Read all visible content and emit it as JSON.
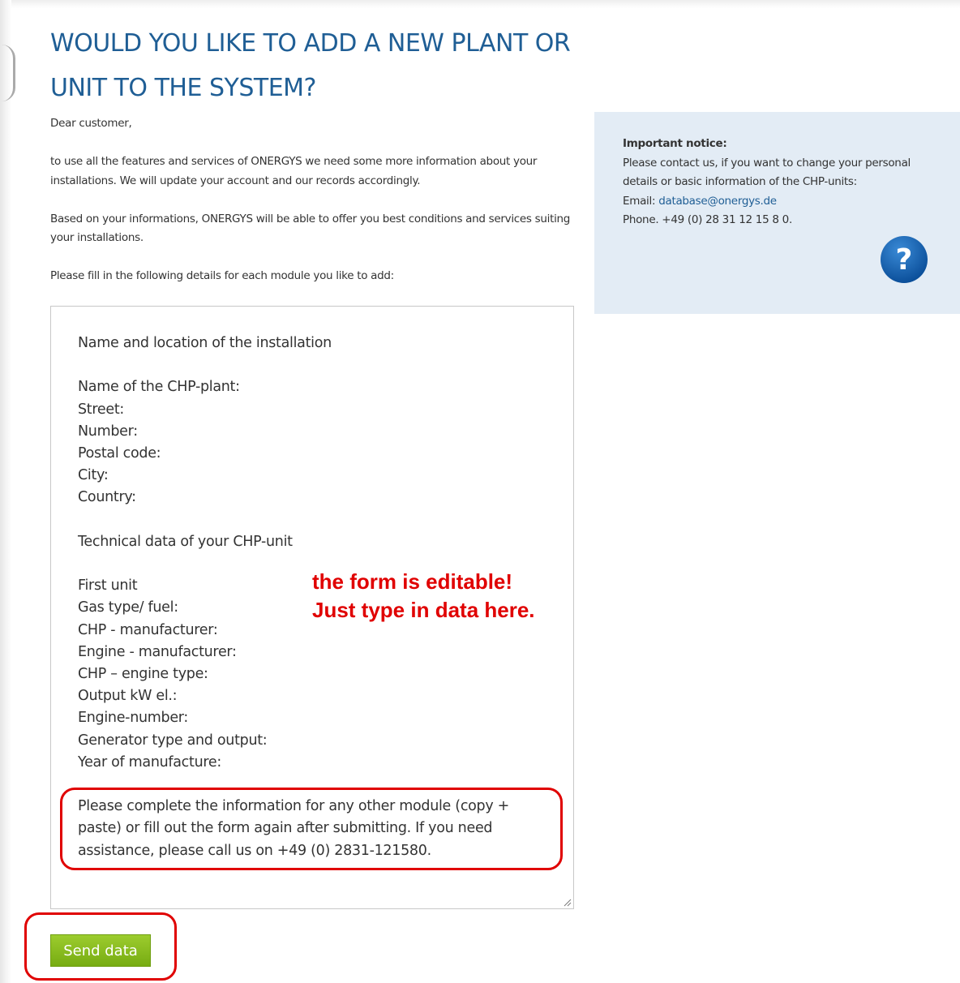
{
  "title": "WOULD YOU LIKE TO ADD A NEW PLANT OR UNIT TO THE SYSTEM?",
  "intro": {
    "greeting": "Dear customer,",
    "paragraph1": "to use all the features and services of ONERGYS we need some more information about your installations. We will update your account and our records accordingly.",
    "paragraph2": "Based on your informations, ONERGYS will be able to offer you best conditions and services suiting your installations.",
    "paragraph3": "Please fill in the following details for each module you like to add:"
  },
  "notice": {
    "title": "Important notice:",
    "body": "Please contact us, if you want to change your personal details or basic information of the CHP-units:",
    "email_label": "Email: ",
    "email": "database@onergys.de",
    "phone": "Phone. +49 (0) 28 31  12 15 8 0.",
    "help_icon": "question-mark-icon",
    "help_symbol": "?"
  },
  "form": {
    "section1_heading": "Name and location of the installation",
    "section1_fields": [
      "Name of the CHP-plant:",
      "Street:",
      "Number:",
      "Postal code:",
      "City:",
      "Country:"
    ],
    "section2_heading": "Technical data of your CHP-unit",
    "section2_fields": [
      "First unit",
      "Gas type/ fuel:",
      "CHP - manufacturer:",
      "Engine - manufacturer:",
      "CHP – engine type:",
      "Output kW el.:",
      "Engine-number:",
      "Generator type and output:",
      "Year of manufacture:"
    ],
    "footer_note": "Please complete the information for any other module (copy + paste) or fill out the form again after submitting. If you need assistance, please call us on +49 (0) 2831-121580."
  },
  "annotation": {
    "line1": "the form is editable!",
    "line2": "Just type in data here."
  },
  "send_button_label": "Send data",
  "colors": {
    "heading": "#1f5e95",
    "notice_bg": "#e3ecf5",
    "annotation": "#e00000",
    "button": "#8bc21f"
  }
}
